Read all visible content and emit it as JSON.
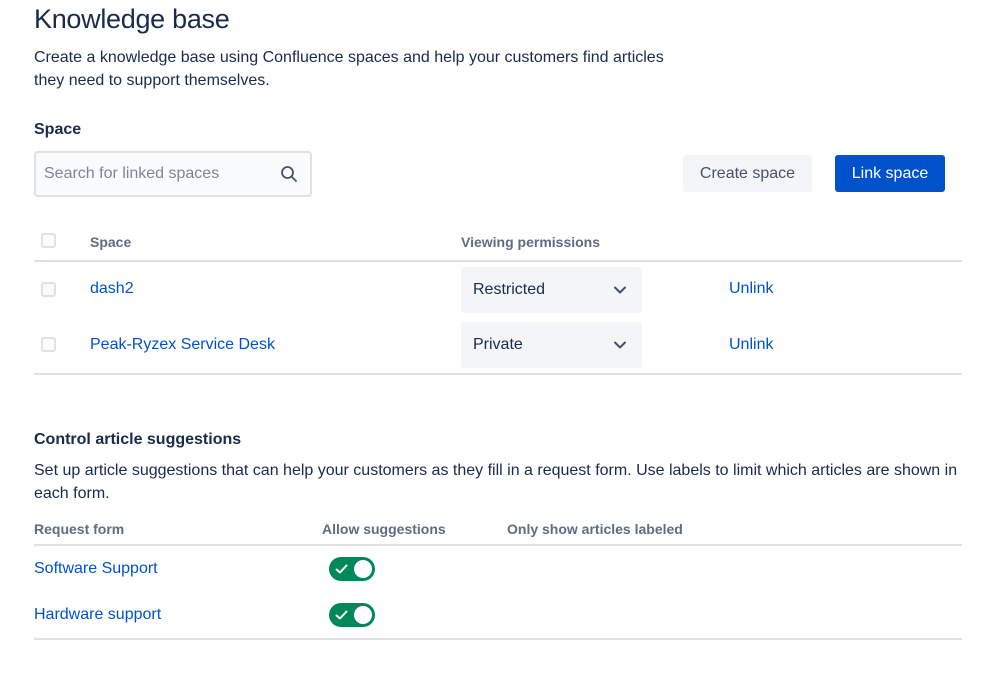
{
  "page": {
    "title": "Knowledge base",
    "intro": "Create a knowledge base using Confluence spaces and help your customers find articles they need to support themselves."
  },
  "space_section": {
    "heading": "Space",
    "search": {
      "placeholder": "Search for linked spaces",
      "value": "",
      "icon": "search-icon"
    },
    "create_button": "Create space",
    "link_button": "Link space",
    "table": {
      "headers": {
        "space": "Space",
        "viewing_permissions": "Viewing permissions"
      },
      "rows": [
        {
          "name": "dash2",
          "permission": "Restricted",
          "action": "Unlink",
          "checked": false
        },
        {
          "name": "Peak-Ryzex Service Desk",
          "permission": "Private",
          "action": "Unlink",
          "checked": false
        }
      ]
    }
  },
  "suggestions_section": {
    "heading": "Control article suggestions",
    "description": "Set up article suggestions that can help your customers as they fill in a request form. Use labels to limit which articles are shown in each form.",
    "headers": {
      "request_form": "Request form",
      "allow_suggestions": "Allow suggestions",
      "only_show_labeled": "Only show articles labeled"
    },
    "rows": [
      {
        "form": "Software Support",
        "allow": true
      },
      {
        "form": "Hardware support",
        "allow": true
      }
    ]
  },
  "colors": {
    "primary": "#0052cc",
    "text": "#172b4d",
    "subtle_text": "#5e6c84",
    "toggle_on": "#00875a",
    "border": "#dfe1e6"
  }
}
